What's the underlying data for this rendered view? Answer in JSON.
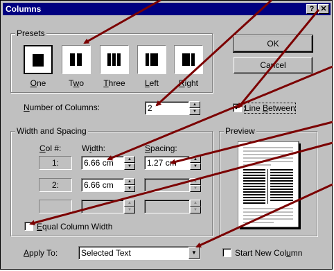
{
  "window": {
    "title": "Columns",
    "help_glyph": "?",
    "close_glyph": "✕"
  },
  "presets": {
    "label": "Presets",
    "items": [
      {
        "label": "One",
        "accel": "O",
        "rest": "ne"
      },
      {
        "label": "Two",
        "accel": "w",
        "pre": "T",
        "rest": "o"
      },
      {
        "label": "Three",
        "accel": "T",
        "rest": "hree"
      },
      {
        "label": "Left",
        "accel": "L",
        "rest": "eft"
      },
      {
        "label": "Right",
        "accel": "R",
        "rest": "ight"
      }
    ]
  },
  "number_of_columns": {
    "label": "Number of Columns:",
    "accel": "N",
    "rest": "umber of Columns:",
    "value": "2"
  },
  "line_between": {
    "label": "Line Between",
    "pre": "Line ",
    "accel": "B",
    "rest": "etween",
    "checked": true,
    "check_glyph": "✔"
  },
  "width_spacing": {
    "label": "Width and Spacing",
    "headers": {
      "col": "Col #:",
      "col_accel": "C",
      "col_rest": "ol #:",
      "width_pre": "W",
      "width_accel": "i",
      "width_rest": "dth:",
      "spacing_pre": "",
      "spacing_accel": "S",
      "spacing_rest": "pacing:"
    },
    "rows": [
      {
        "col": "1:",
        "width": "6.66 cm",
        "spacing": "1.27 cm"
      },
      {
        "col": "2:",
        "width": "6.66 cm",
        "spacing": ""
      },
      {
        "col": "",
        "width": "",
        "spacing": ""
      }
    ]
  },
  "equal_width": {
    "label": "Equal Column Width",
    "accel": "E",
    "rest": "qual Column Width",
    "checked": false
  },
  "buttons": {
    "ok": "OK",
    "cancel": "Cancel"
  },
  "preview": {
    "label": "Preview"
  },
  "apply_to": {
    "label": "Apply To:",
    "accel": "A",
    "rest": "pply To:",
    "value": "Selected Text"
  },
  "start_new_column": {
    "label": "Start New Column",
    "pre": "Start New Col",
    "accel": "u",
    "rest": "mn",
    "checked": false
  },
  "colors": {
    "titlebar": "#000080",
    "face": "#c0c0c0",
    "annotation_arrow": "#7b0000"
  }
}
